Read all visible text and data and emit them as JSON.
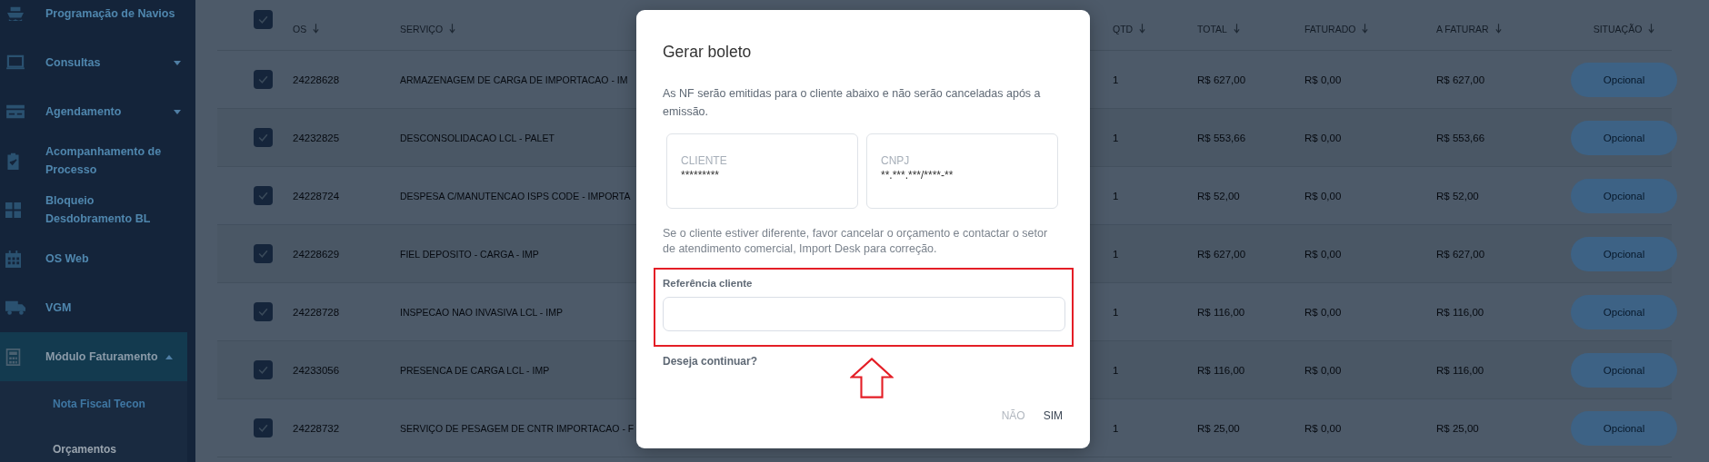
{
  "sidebar": {
    "items": [
      {
        "label": "Programação de Navios",
        "selected": false
      },
      {
        "label": "Consultas",
        "selected": false,
        "expanded": false
      },
      {
        "label": "Agendamento",
        "selected": false,
        "expanded": false
      },
      {
        "label": "Acompanhamento de Processo",
        "selected": false
      },
      {
        "label": "Bloqueio Desdobramento BL",
        "selected": false
      },
      {
        "label": "OS Web",
        "selected": false
      },
      {
        "label": "VGM",
        "selected": false
      },
      {
        "label": "Módulo Faturamento",
        "selected": true,
        "expanded": true,
        "children": [
          {
            "label": "Nota Fiscal Tecon",
            "selected": false
          },
          {
            "label": "Orçamentos",
            "selected": true
          }
        ]
      }
    ]
  },
  "table": {
    "all_checked": true,
    "columns": [
      {
        "label": "OS"
      },
      {
        "label": "SERVIÇO"
      },
      {
        "label": "QTD"
      },
      {
        "label": "TOTAL"
      },
      {
        "label": "FATURADO"
      },
      {
        "label": "A FATURAR"
      },
      {
        "label": "SITUAÇÃO"
      }
    ],
    "rows": [
      {
        "checked": true,
        "os": "24228628",
        "servico": "ARMAZENAGEM DE CARGA DE IMPORTACAO - IM",
        "qtd": "1",
        "total": "R$ 627,00",
        "faturado": "R$ 0,00",
        "a_faturar": "R$ 627,00",
        "situacao": "Opcional"
      },
      {
        "checked": true,
        "os": "24232825",
        "servico": "DESCONSOLIDACAO LCL - PALET",
        "qtd": "1",
        "total": "R$ 553,66",
        "faturado": "R$ 0,00",
        "a_faturar": "R$ 553,66",
        "situacao": "Opcional"
      },
      {
        "checked": true,
        "os": "24228724",
        "servico": "DESPESA C/MANUTENCAO ISPS CODE - IMPORTA",
        "qtd": "1",
        "total": "R$ 52,00",
        "faturado": "R$ 0,00",
        "a_faturar": "R$ 52,00",
        "situacao": "Opcional"
      },
      {
        "checked": true,
        "os": "24228629",
        "servico": "FIEL DEPOSITO - CARGA - IMP",
        "qtd": "1",
        "total": "R$ 627,00",
        "faturado": "R$ 0,00",
        "a_faturar": "R$ 627,00",
        "situacao": "Opcional"
      },
      {
        "checked": true,
        "os": "24228728",
        "servico": "INSPECAO NAO INVASIVA LCL - IMP",
        "qtd": "1",
        "total": "R$ 116,00",
        "faturado": "R$ 0,00",
        "a_faturar": "R$ 116,00",
        "situacao": "Opcional"
      },
      {
        "checked": true,
        "os": "24233056",
        "servico": "PRESENCA DE CARGA LCL - IMP",
        "qtd": "1",
        "total": "R$ 116,00",
        "faturado": "R$ 0,00",
        "a_faturar": "R$ 116,00",
        "situacao": "Opcional"
      },
      {
        "checked": true,
        "os": "24228732",
        "servico": "SERVIÇO DE PESAGEM DE CNTR IMPORTACAO - F",
        "qtd": "1",
        "total": "R$ 25,00",
        "faturado": "R$ 0,00",
        "a_faturar": "R$ 25,00",
        "situacao": "Opcional"
      }
    ]
  },
  "dialog": {
    "title": "Gerar boleto",
    "message": "As NF serão emitidas para o cliente abaixo e não serão canceladas após a emissão.",
    "info": [
      {
        "label": "CLIENTE",
        "value": "*********"
      },
      {
        "label": "CNPJ",
        "value": "**.***.***/****-**"
      }
    ],
    "note": "Se o cliente estiver diferente, favor cancelar o orçamento e contactar o setor de atendimento comercial, Import Desk para correção.",
    "reference_label": "Referência cliente",
    "question": "Deseja continuar?",
    "buttons": [
      {
        "label": "NÃO",
        "disabled": true
      },
      {
        "label": "SIM",
        "disabled": false
      }
    ]
  }
}
